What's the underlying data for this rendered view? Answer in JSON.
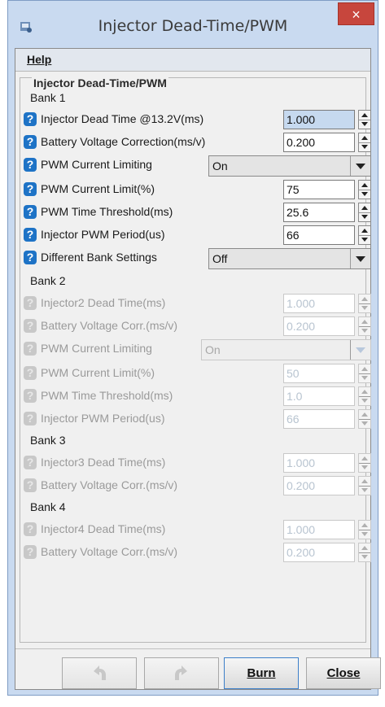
{
  "window": {
    "title": "Injector Dead-Time/PWM",
    "close_glyph": "×"
  },
  "menu": {
    "help": "Help"
  },
  "panel": {
    "title": "Injector Dead-Time/PWM"
  },
  "bank1": {
    "heading": "Bank 1",
    "dead_time": {
      "label": "Injector Dead Time @13.2V(ms)",
      "value": "1.000"
    },
    "batt_corr": {
      "label": "Battery Voltage Correction(ms/v)",
      "value": "0.200"
    },
    "pwm_limiting": {
      "label": "PWM Current Limiting",
      "value": "On"
    },
    "pwm_limit": {
      "label": "PWM Current Limit(%)",
      "value": "75"
    },
    "pwm_threshold": {
      "label": "PWM Time Threshold(ms)",
      "value": "25.6"
    },
    "pwm_period": {
      "label": "Injector PWM Period(us)",
      "value": "66"
    },
    "diff_bank": {
      "label": "Different Bank Settings",
      "value": "Off"
    }
  },
  "bank2": {
    "heading": "Bank 2",
    "dead_time": {
      "label": "Injector2 Dead Time(ms)",
      "value": "1.000"
    },
    "batt_corr": {
      "label": "Battery Voltage Corr.(ms/v)",
      "value": "0.200"
    },
    "pwm_limiting": {
      "label": "PWM Current Limiting",
      "value": "On"
    },
    "pwm_limit": {
      "label": "PWM Current Limit(%)",
      "value": "50"
    },
    "pwm_threshold": {
      "label": "PWM Time Threshold(ms)",
      "value": "1.0"
    },
    "pwm_period": {
      "label": "Injector PWM Period(us)",
      "value": "66"
    }
  },
  "bank3": {
    "heading": "Bank 3",
    "dead_time": {
      "label": "Injector3 Dead Time(ms)",
      "value": "1.000"
    },
    "batt_corr": {
      "label": "Battery Voltage Corr.(ms/v)",
      "value": "0.200"
    }
  },
  "bank4": {
    "heading": "Bank 4",
    "dead_time": {
      "label": "Injector4 Dead Time(ms)",
      "value": "1.000"
    },
    "batt_corr": {
      "label": "Battery Voltage Corr.(ms/v)",
      "value": "0.200"
    }
  },
  "buttons": {
    "undo_icon": "undo-arrow-icon",
    "redo_icon": "redo-arrow-icon",
    "burn": "Burn",
    "close": "Close"
  },
  "colors": {
    "help_icon": "#1e73c6",
    "title_bar": "#c9daf0",
    "close_button": "#c7463d"
  }
}
